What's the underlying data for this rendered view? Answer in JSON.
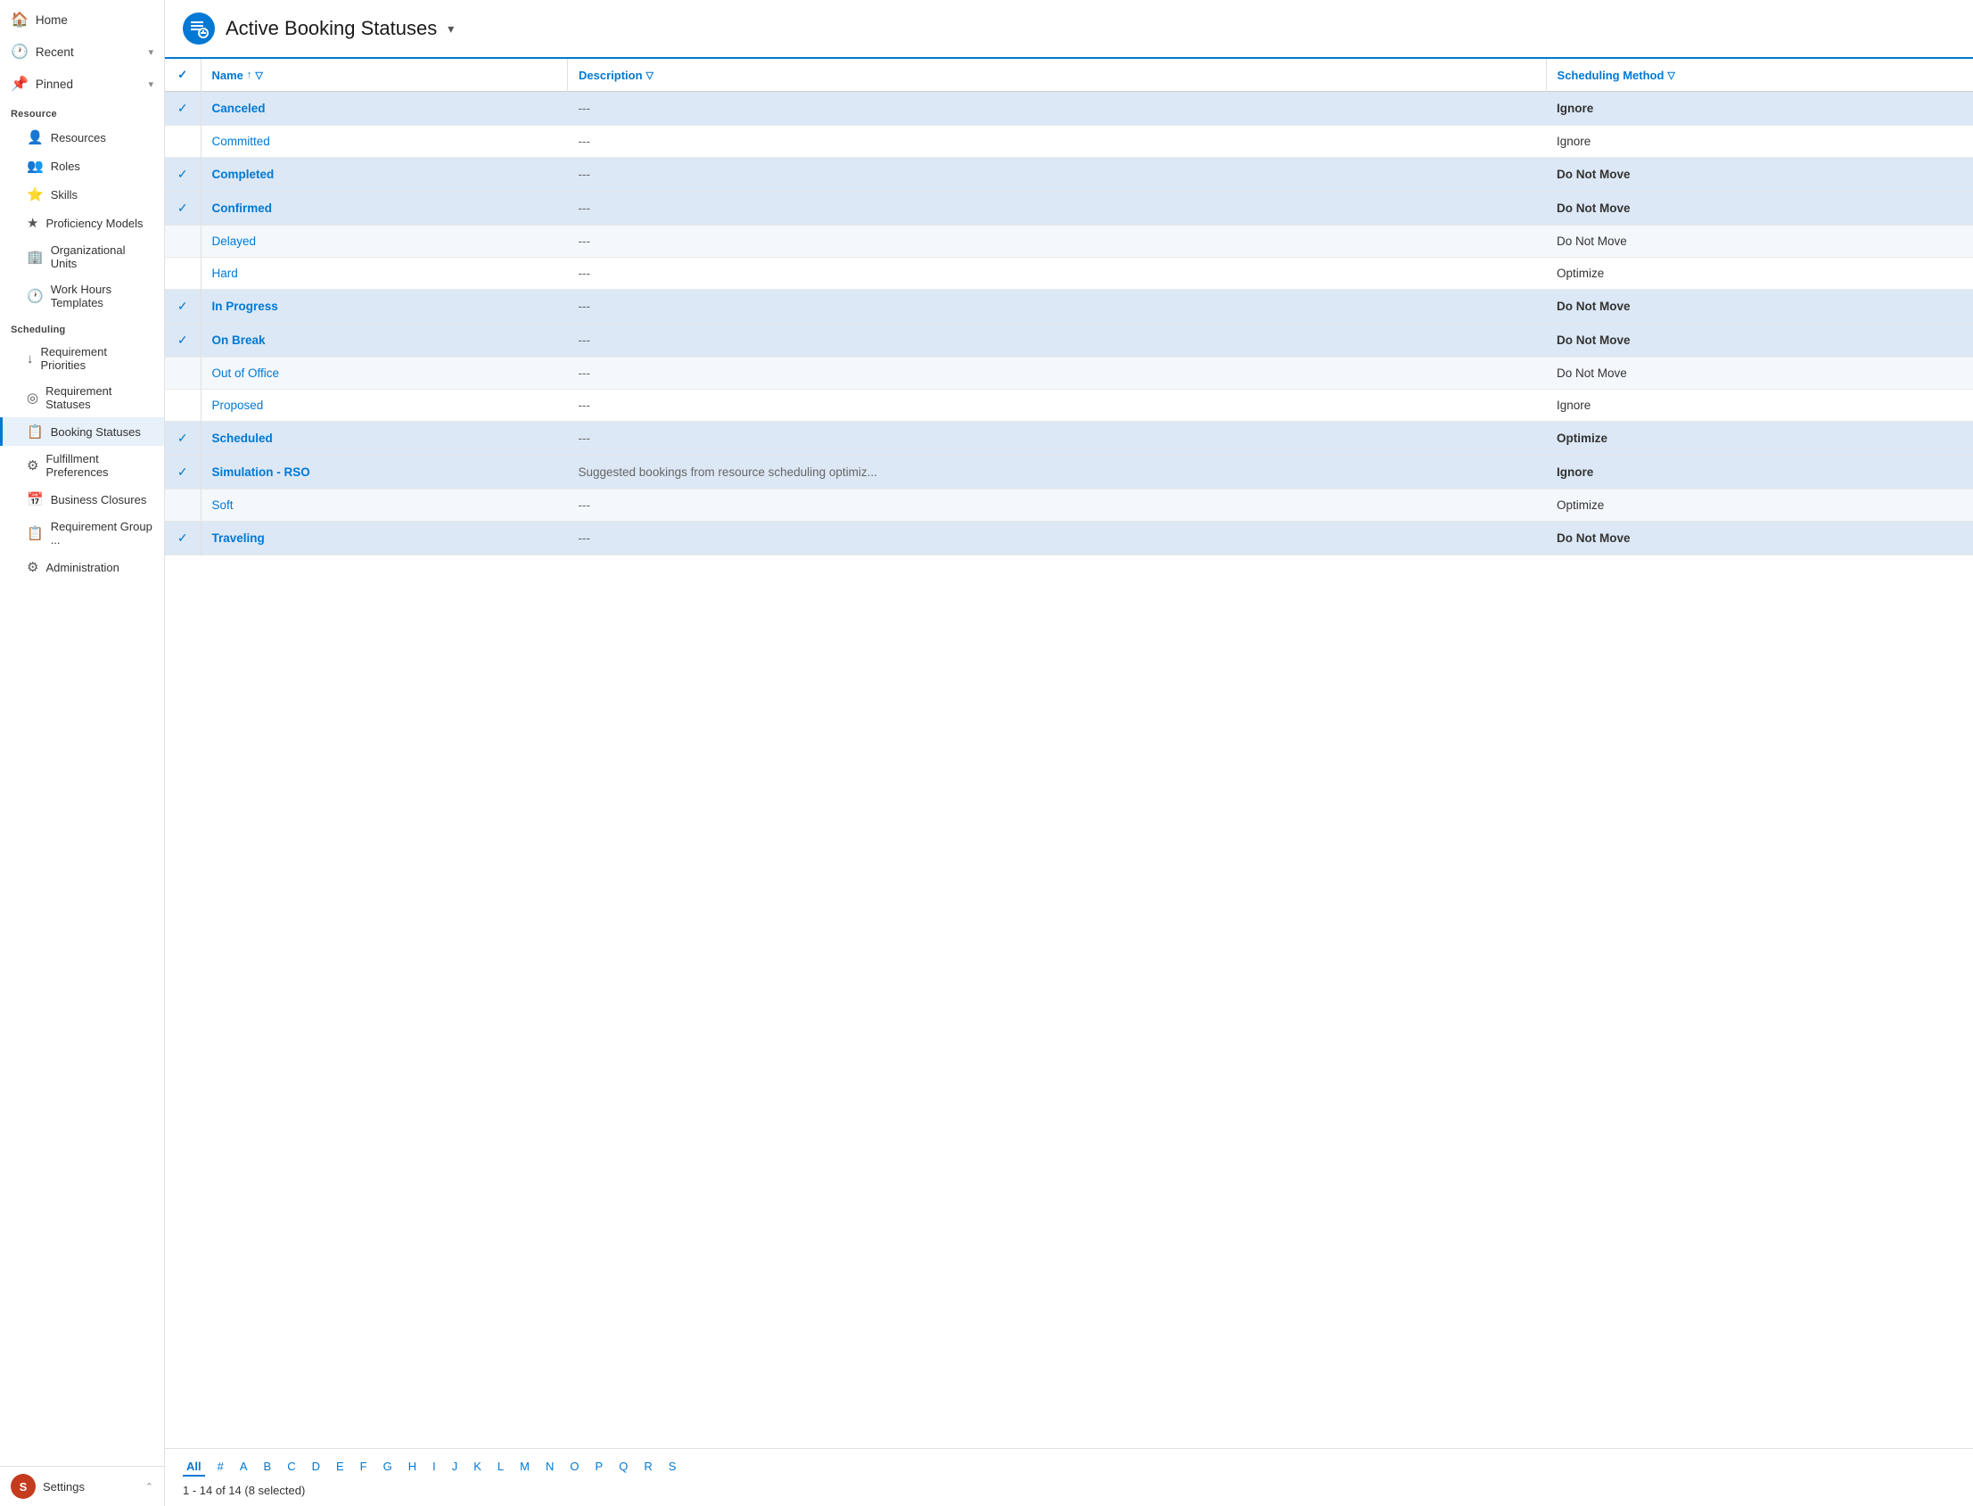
{
  "sidebar": {
    "nav_items": [
      {
        "id": "home",
        "label": "Home",
        "icon": "🏠"
      },
      {
        "id": "recent",
        "label": "Recent",
        "icon": "🕐",
        "chevron": "▾"
      },
      {
        "id": "pinned",
        "label": "Pinned",
        "icon": "📌",
        "chevron": "▾"
      }
    ],
    "sections": [
      {
        "header": "Resource",
        "items": [
          {
            "id": "resources",
            "label": "Resources",
            "icon": "👤"
          },
          {
            "id": "roles",
            "label": "Roles",
            "icon": "👥"
          },
          {
            "id": "skills",
            "label": "Skills",
            "icon": "⭐"
          },
          {
            "id": "proficiency-models",
            "label": "Proficiency Models",
            "icon": "★"
          },
          {
            "id": "organizational-units",
            "label": "Organizational Units",
            "icon": "🏢"
          },
          {
            "id": "work-hours-templates",
            "label": "Work Hours Templates",
            "icon": "🕐"
          }
        ]
      },
      {
        "header": "Scheduling",
        "items": [
          {
            "id": "requirement-priorities",
            "label": "Requirement Priorities",
            "icon": "↓"
          },
          {
            "id": "requirement-statuses",
            "label": "Requirement Statuses",
            "icon": "◎"
          },
          {
            "id": "booking-statuses",
            "label": "Booking Statuses",
            "icon": "📋",
            "active": true
          },
          {
            "id": "fulfillment-preferences",
            "label": "Fulfillment Preferences",
            "icon": "⚙"
          },
          {
            "id": "business-closures",
            "label": "Business Closures",
            "icon": "📅"
          },
          {
            "id": "requirement-group",
            "label": "Requirement Group ...",
            "icon": "📋"
          },
          {
            "id": "administration",
            "label": "Administration",
            "icon": "⚙"
          }
        ]
      }
    ],
    "bottom": {
      "avatar_letter": "S",
      "label": "Settings"
    }
  },
  "header": {
    "app_icon": "📋",
    "title": "Active Booking Statuses",
    "dropdown_icon": "▾"
  },
  "table": {
    "columns": [
      {
        "id": "check",
        "label": ""
      },
      {
        "id": "name",
        "label": "Name",
        "sort": true,
        "filter": true
      },
      {
        "id": "description",
        "label": "Description",
        "filter": true
      },
      {
        "id": "scheduling_method",
        "label": "Scheduling Method",
        "filter": true
      }
    ],
    "rows": [
      {
        "id": 1,
        "selected": true,
        "name": "Canceled",
        "description": "---",
        "method": "Ignore",
        "checked": true
      },
      {
        "id": 2,
        "selected": false,
        "name": "Committed",
        "description": "---",
        "method": "Ignore",
        "checked": false
      },
      {
        "id": 3,
        "selected": true,
        "name": "Completed",
        "description": "---",
        "method": "Do Not Move",
        "checked": true
      },
      {
        "id": 4,
        "selected": true,
        "name": "Confirmed",
        "description": "---",
        "method": "Do Not Move",
        "checked": true
      },
      {
        "id": 5,
        "selected": false,
        "name": "Delayed",
        "description": "---",
        "method": "Do Not Move",
        "checked": false
      },
      {
        "id": 6,
        "selected": false,
        "name": "Hard",
        "description": "---",
        "method": "Optimize",
        "checked": false
      },
      {
        "id": 7,
        "selected": true,
        "name": "In Progress",
        "description": "---",
        "method": "Do Not Move",
        "checked": true
      },
      {
        "id": 8,
        "selected": true,
        "name": "On Break",
        "description": "---",
        "method": "Do Not Move",
        "checked": true
      },
      {
        "id": 9,
        "selected": false,
        "name": "Out of Office",
        "description": "---",
        "method": "Do Not Move",
        "checked": false
      },
      {
        "id": 10,
        "selected": false,
        "name": "Proposed",
        "description": "---",
        "method": "Ignore",
        "checked": false
      },
      {
        "id": 11,
        "selected": true,
        "name": "Scheduled",
        "description": "---",
        "method": "Optimize",
        "checked": true
      },
      {
        "id": 12,
        "selected": true,
        "name": "Simulation - RSO",
        "description": "Suggested bookings from resource scheduling optimiz...",
        "method": "Ignore",
        "checked": true
      },
      {
        "id": 13,
        "selected": false,
        "name": "Soft",
        "description": "---",
        "method": "Optimize",
        "checked": false
      },
      {
        "id": 14,
        "selected": true,
        "name": "Traveling",
        "description": "---",
        "method": "Do Not Move",
        "checked": true
      }
    ]
  },
  "pagination": {
    "alpha": [
      "All",
      "#",
      "A",
      "B",
      "C",
      "D",
      "E",
      "F",
      "G",
      "H",
      "I",
      "J",
      "K",
      "L",
      "M",
      "N",
      "O",
      "P",
      "Q",
      "R",
      "S"
    ],
    "active_alpha": "All",
    "info": "1 - 14 of 14 (8 selected)"
  }
}
